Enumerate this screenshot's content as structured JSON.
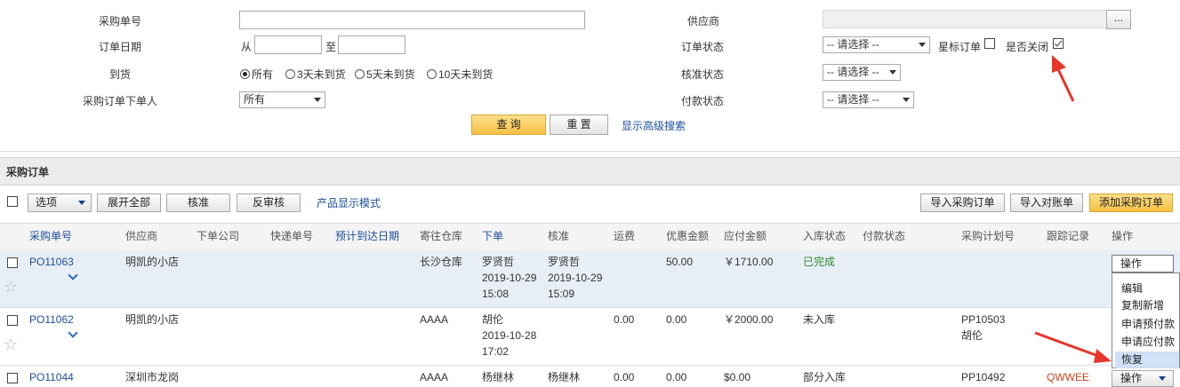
{
  "search": {
    "po_no_label": "采购单号",
    "order_date_label": "订单日期",
    "from_label": "从",
    "to_label": "至",
    "arrival_label": "到货",
    "arrival_options": [
      "所有",
      "3天未到货",
      "5天未到货",
      "10天未到货"
    ],
    "orderer_label": "采购订单下单人",
    "orderer_value": "所有",
    "supplier_label": "供应商",
    "supplier_btn": "...",
    "order_status_label": "订单状态",
    "order_status_value": "-- 请选择 --",
    "star_label": "星标订单",
    "closed_label": "是否关闭",
    "approve_status_label": "核准状态",
    "approve_status_value": "-- 请选择 --",
    "pay_status_label": "付款状态",
    "pay_status_value": "-- 请选择 --",
    "query_btn": "查 询",
    "reset_btn": "重 置",
    "advanced_link": "显示高级搜索"
  },
  "section_title": "采购订单",
  "toolbar": {
    "options": "选项",
    "expand_all": "展开全部",
    "approve": "核准",
    "unapprove": "反审核",
    "display_mode": "产品显示模式",
    "import_po": "导入采购订单",
    "import_statement": "导入对账单",
    "add_po": "添加采购订单"
  },
  "table": {
    "headers": [
      "采购单号",
      "供应商",
      "下单公司",
      "快递单号",
      "预计到达日期",
      "寄往仓库",
      "下单",
      "核准",
      "运费",
      "优惠金额",
      "应付金额",
      "入库状态",
      "付款状态",
      "采购计划号",
      "跟踪记录",
      "操作"
    ],
    "rows": [
      {
        "po": "PO11063",
        "supplier": "明凯的小店",
        "warehouse": "长沙仓库",
        "ordered_by": "罗贤哲",
        "ordered_date": "2019-10-29",
        "ordered_time": "15:08",
        "approved_by": "罗贤哲",
        "approved_date": "2019-10-29",
        "approved_time": "15:09",
        "freight": "",
        "discount": "50.00",
        "payable": "￥1710.00",
        "in_status": "已完成",
        "plan_no": "",
        "plan_user": "",
        "track": "",
        "op": "操作"
      },
      {
        "po": "PO11062",
        "supplier": "明凯的小店",
        "warehouse": "AAAA",
        "ordered_by": "胡伦",
        "ordered_date": "2019-10-28",
        "ordered_time": "17:02",
        "approved_by": "",
        "approved_date": "",
        "approved_time": "",
        "freight": "0.00",
        "discount": "0.00",
        "payable": "￥2000.00",
        "in_status": "未入库",
        "plan_no": "PP10503",
        "plan_user": "胡伦",
        "track": "",
        "op": ""
      },
      {
        "po": "PO11044",
        "supplier": "深圳市龙岗",
        "warehouse": "AAAA",
        "ordered_by": "杨继林",
        "ordered_date": "",
        "ordered_time": "",
        "approved_by": "杨继林",
        "approved_date": "",
        "approved_time": "",
        "freight": "0.00",
        "discount": "0.00",
        "payable": "$0.00",
        "in_status": "部分入库",
        "plan_no": "PP10492",
        "plan_user": "",
        "track": "QWWEE",
        "op": "操作"
      }
    ]
  },
  "op_menu": [
    "编辑",
    "复制新增",
    "申请预付款",
    "申请应付款",
    "恢复"
  ],
  "colors": {
    "link": "#1a4e9c",
    "done": "#2e8b2e",
    "track": "#d0421b",
    "arrow": "#e8352a",
    "highlight": "#cfe0f7"
  }
}
